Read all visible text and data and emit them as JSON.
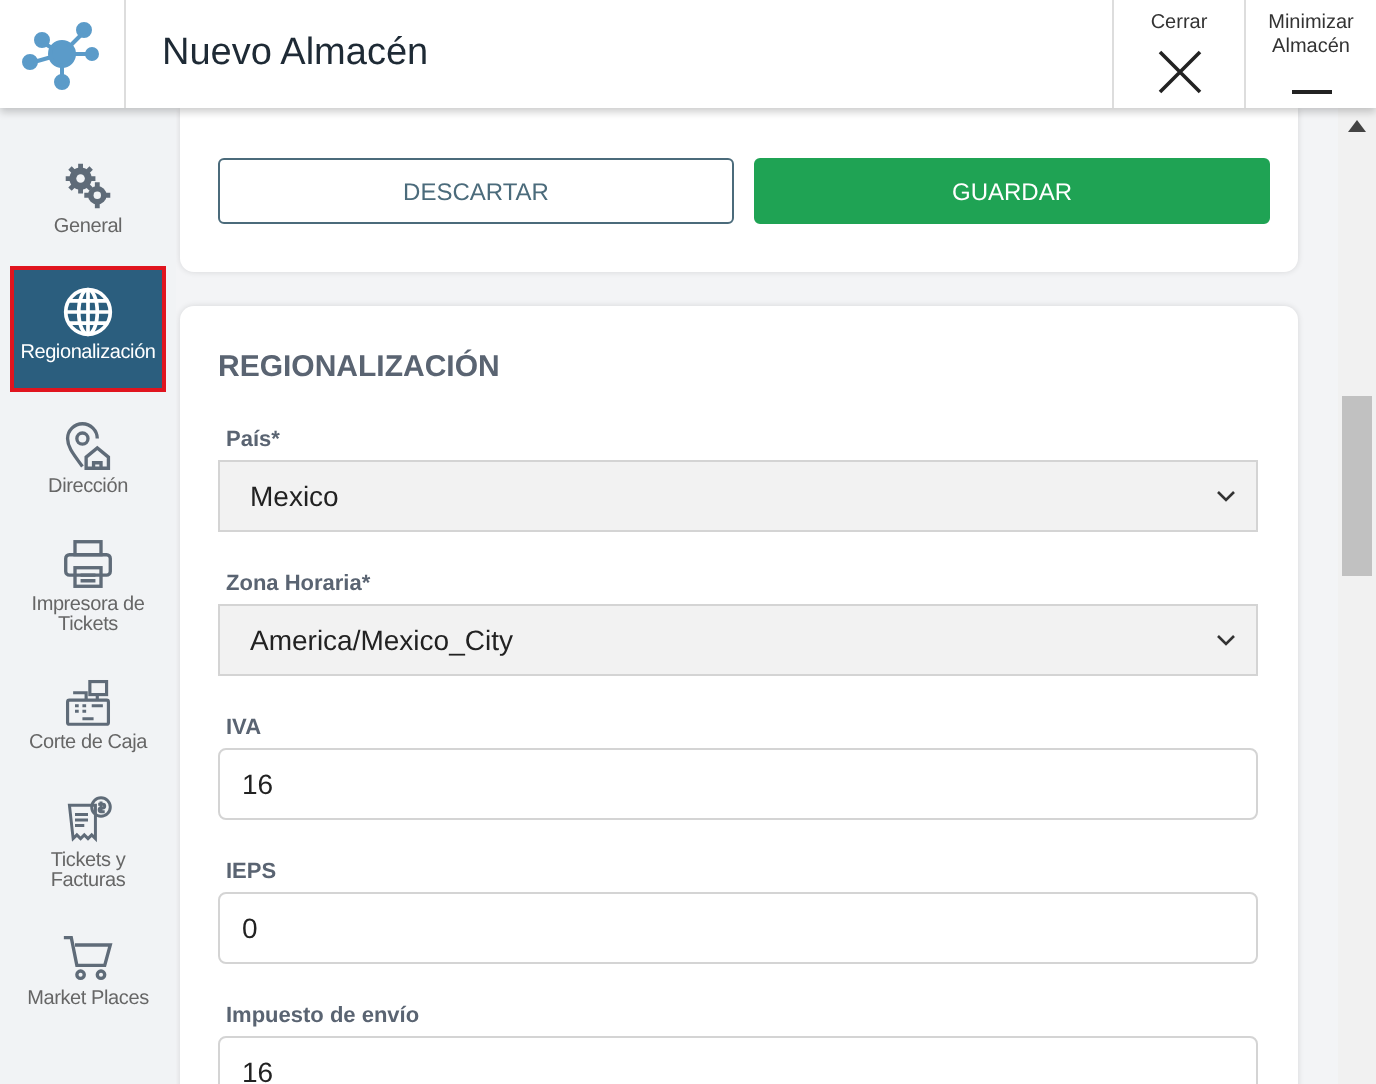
{
  "header": {
    "title": "Nuevo Almacén",
    "actions": [
      {
        "kind": "close",
        "label": "Cerrar"
      },
      {
        "kind": "minimize",
        "label": "Minimizar Almacén"
      }
    ]
  },
  "sidebar": {
    "items": [
      {
        "kind": "gears",
        "label": "General",
        "selected": false
      },
      {
        "kind": "globe",
        "label": "Regionalización",
        "selected": true
      },
      {
        "kind": "location",
        "label": "Dirección",
        "selected": false
      },
      {
        "kind": "printer",
        "label": "Impresora de Tickets",
        "selected": false
      },
      {
        "kind": "register",
        "label": "Corte de Caja",
        "selected": false
      },
      {
        "kind": "receipt",
        "label": "Tickets y Facturas",
        "selected": false
      },
      {
        "kind": "cart",
        "label": "Market Places",
        "selected": false
      }
    ]
  },
  "actions": [
    {
      "kind": "secondary",
      "label": "DESCARTAR"
    },
    {
      "kind": "primary",
      "label": "GUARDAR"
    }
  ],
  "section": {
    "title": "REGIONALIZACIÓN",
    "fields": [
      {
        "kind": "select",
        "label": "País*",
        "value": "Mexico"
      },
      {
        "kind": "select",
        "label": "Zona Horaria*",
        "value": "America/Mexico_City"
      },
      {
        "kind": "input",
        "label": "IVA",
        "value": "16"
      },
      {
        "kind": "input",
        "label": "IEPS",
        "value": "0"
      },
      {
        "kind": "input",
        "label": "Impuesto de envío",
        "value": "16"
      }
    ]
  }
}
